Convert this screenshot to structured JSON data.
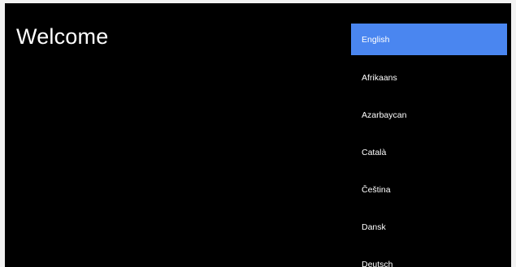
{
  "title": "Welcome",
  "colors": {
    "background": "#000000",
    "frame": "#f2f2f2",
    "selected_highlight": "#4a86f0",
    "text": "#ffffff"
  },
  "languages": [
    {
      "label": "English",
      "selected": true
    },
    {
      "label": "Afrikaans",
      "selected": false
    },
    {
      "label": "Azarbaycan",
      "selected": false
    },
    {
      "label": "Català",
      "selected": false
    },
    {
      "label": "Čeština",
      "selected": false
    },
    {
      "label": "Dansk",
      "selected": false
    },
    {
      "label": "Deutsch",
      "selected": false
    }
  ]
}
